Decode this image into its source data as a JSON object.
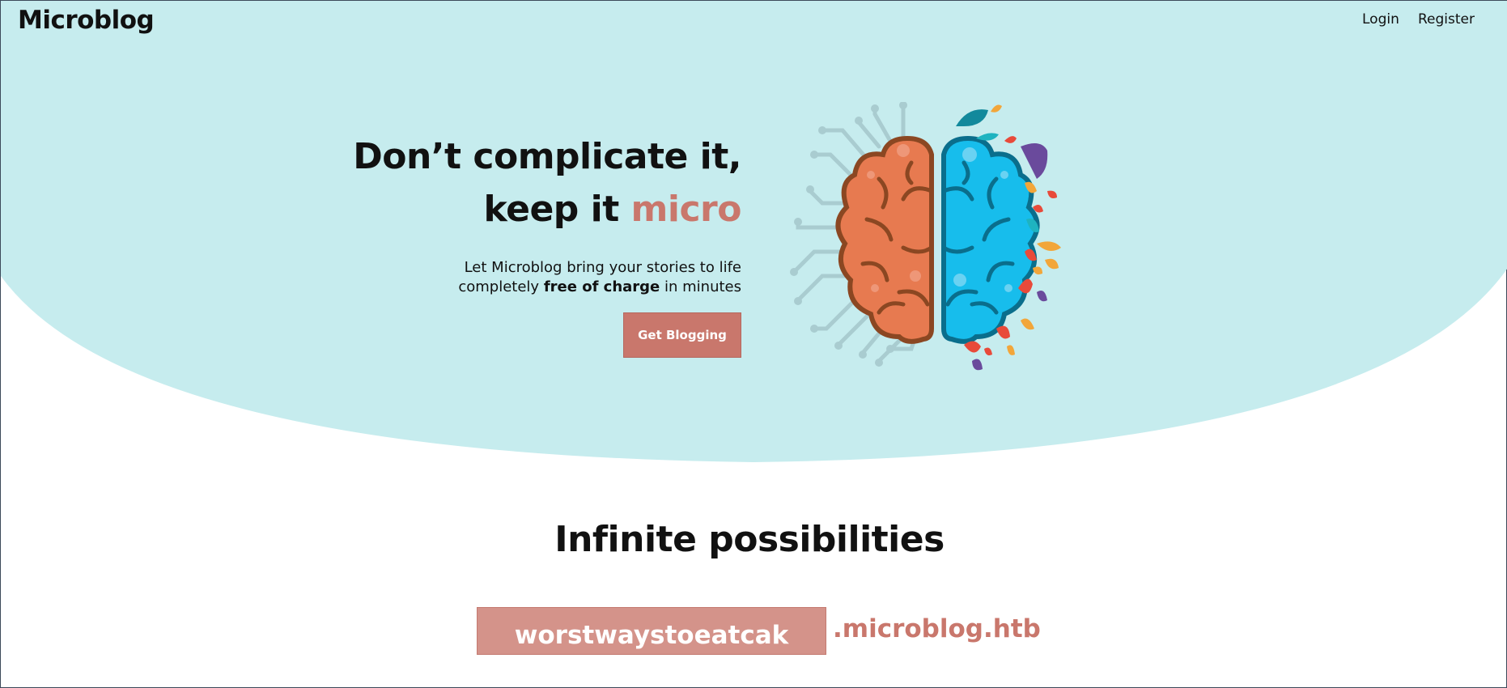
{
  "nav": {
    "brand": "Microblog",
    "login": "Login",
    "register": "Register"
  },
  "hero": {
    "headline_line1": "Don’t complicate it,",
    "headline_line2_prefix": "keep it ",
    "headline_line2_accent": "micro",
    "sub_line1": "Let Microblog bring your stories to life",
    "sub_line2_prefix": "completely ",
    "sub_line2_bold": "free of charge",
    "sub_line2_suffix": " in minutes",
    "cta": "Get Blogging"
  },
  "section": {
    "title": "Infinite possibilities",
    "subdomain_value": "worstwaystoeatcak",
    "domain_suffix": ".microblog.htb"
  },
  "colors": {
    "hero_bg": "#c6ecee",
    "accent": "#c9776c",
    "input_bg": "#d4938a"
  },
  "icons": [
    "brain-illustration"
  ]
}
